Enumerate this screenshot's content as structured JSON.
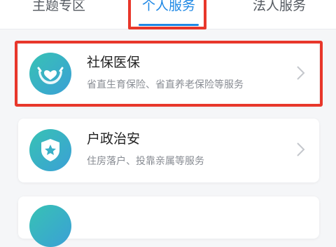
{
  "tabs": [
    {
      "label": "主题专区",
      "active": false
    },
    {
      "label": "个人服务",
      "active": true
    },
    {
      "label": "法人服务",
      "active": false
    }
  ],
  "accent_color": "#1e88e5",
  "highlight_color": "#e8372b",
  "services": [
    {
      "title": "社保医保",
      "subtitle": "省直生育保险、省直养老保险等服务",
      "icon": "hands-heart-icon"
    },
    {
      "title": "户政治安",
      "subtitle": "住房落户、投靠亲属等服务",
      "icon": "police-badge-icon"
    },
    {
      "title": "",
      "subtitle": "",
      "icon": "service-icon"
    }
  ]
}
